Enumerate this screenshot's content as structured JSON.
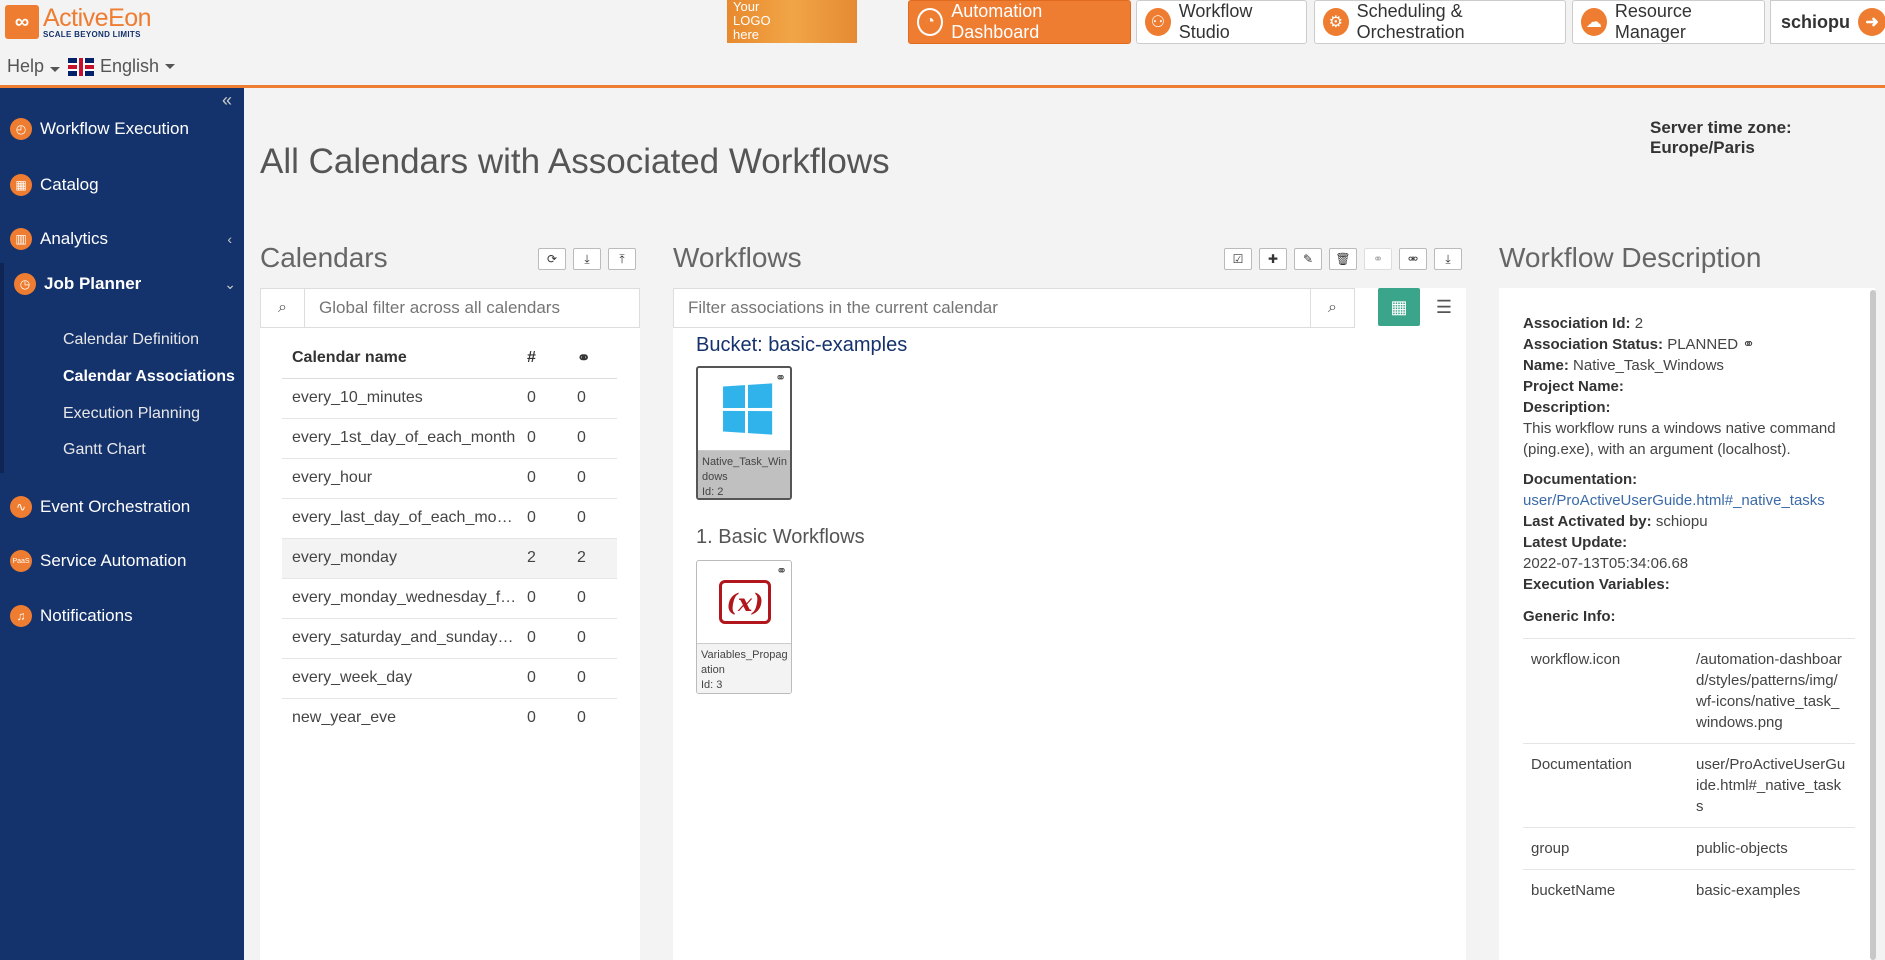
{
  "header": {
    "brand": "ActiveEon",
    "tagline": "SCALE BEYOND LIMITS",
    "help": "Help",
    "language": "English",
    "your_logo": [
      "Your",
      "LOGO",
      "here"
    ],
    "nav": [
      {
        "label": "Automation Dashboard",
        "icon": "dashboard-gauge-icon",
        "active": true
      },
      {
        "label": "Workflow Studio",
        "icon": "workflow-studio-icon"
      },
      {
        "label": "Scheduling & Orchestration",
        "icon": "gears-icon"
      },
      {
        "label": "Resource Manager",
        "icon": "cloud-icon"
      }
    ],
    "user": "schiopu"
  },
  "sidebar": {
    "items": [
      {
        "label": "Workflow Execution",
        "icon": "workflow-execution-icon"
      },
      {
        "label": "Catalog",
        "icon": "catalog-icon"
      },
      {
        "label": "Analytics",
        "icon": "analytics-icon"
      },
      {
        "label": "Job Planner",
        "icon": "clock-icon"
      },
      {
        "label": "Event Orchestration",
        "icon": "event-pulse-icon"
      },
      {
        "label": "Service Automation",
        "icon": "paas-icon",
        "icon_text": "PaaS"
      },
      {
        "label": "Notifications",
        "icon": "bell-icon"
      }
    ],
    "job_planner_sub": [
      {
        "label": "Calendar Definition"
      },
      {
        "label": "Calendar Associations",
        "active": true
      },
      {
        "label": "Execution Planning"
      },
      {
        "label": "Gantt Chart"
      }
    ]
  },
  "main": {
    "server_tz": "Server time zone: Europe/Paris",
    "title": "All Calendars with Associated Workflows"
  },
  "calendars": {
    "title": "Calendars",
    "search_placeholder": "Global filter across all calendars",
    "columns": [
      "Calendar name",
      "#",
      "link-icon"
    ],
    "rows": [
      {
        "name": "every_10_minutes",
        "count": "0",
        "links": "0"
      },
      {
        "name": "every_1st_day_of_each_month",
        "count": "0",
        "links": "0"
      },
      {
        "name": "every_hour",
        "count": "0",
        "links": "0"
      },
      {
        "name": "every_last_day_of_each_month",
        "count": "0",
        "links": "0"
      },
      {
        "name": "every_monday",
        "count": "2",
        "links": "2",
        "selected": true
      },
      {
        "name": "every_monday_wednesday_fri...",
        "count": "0",
        "links": "0"
      },
      {
        "name": "every_saturday_and_sunday_...",
        "count": "0",
        "links": "0"
      },
      {
        "name": "every_week_day",
        "count": "0",
        "links": "0"
      },
      {
        "name": "new_year_eve",
        "count": "0",
        "links": "0"
      }
    ]
  },
  "workflows": {
    "title": "Workflows",
    "search_placeholder": "Filter associations in the current calendar",
    "bucket": "Bucket: basic-examples",
    "group2": "1. Basic Workflows",
    "cards": [
      {
        "name": "Native_Task_Windows",
        "id": "Id: 2",
        "icon": "windows-logo-icon",
        "selected": true
      },
      {
        "name": "Variables_Propagation",
        "id": "Id: 3",
        "icon": "variables-icon"
      }
    ]
  },
  "description": {
    "title": "Workflow Description",
    "association_id_label": "Association Id:",
    "association_id": "2",
    "association_status_label": "Association Status:",
    "association_status": "PLANNED",
    "name_label": "Name:",
    "name": "Native_Task_Windows",
    "project_label": "Project Name:",
    "description_label": "Description:",
    "description": "This workflow runs a windows native command (ping.exe), with an argument (localhost).",
    "documentation_label": "Documentation:",
    "documentation": "user/ProActiveUserGuide.html#_native_tasks",
    "last_activated_label": "Last Activated by:",
    "last_activated": "schiopu",
    "latest_update_label": "Latest Update:",
    "latest_update": "2022-07-13T05:34:06.68",
    "exec_vars_label": "Execution Variables:",
    "generic_info_label": "Generic Info:",
    "generic_info": [
      {
        "key": "workflow.icon",
        "value": "/automation-dashboard/styles/patterns/img/wf-icons/native_task_windows.png"
      },
      {
        "key": "Documentation",
        "value": "user/ProActiveUserGuide.html#_native_tasks"
      },
      {
        "key": "group",
        "value": "public-objects"
      },
      {
        "key": "bucketName",
        "value": "basic-examples"
      }
    ]
  }
}
